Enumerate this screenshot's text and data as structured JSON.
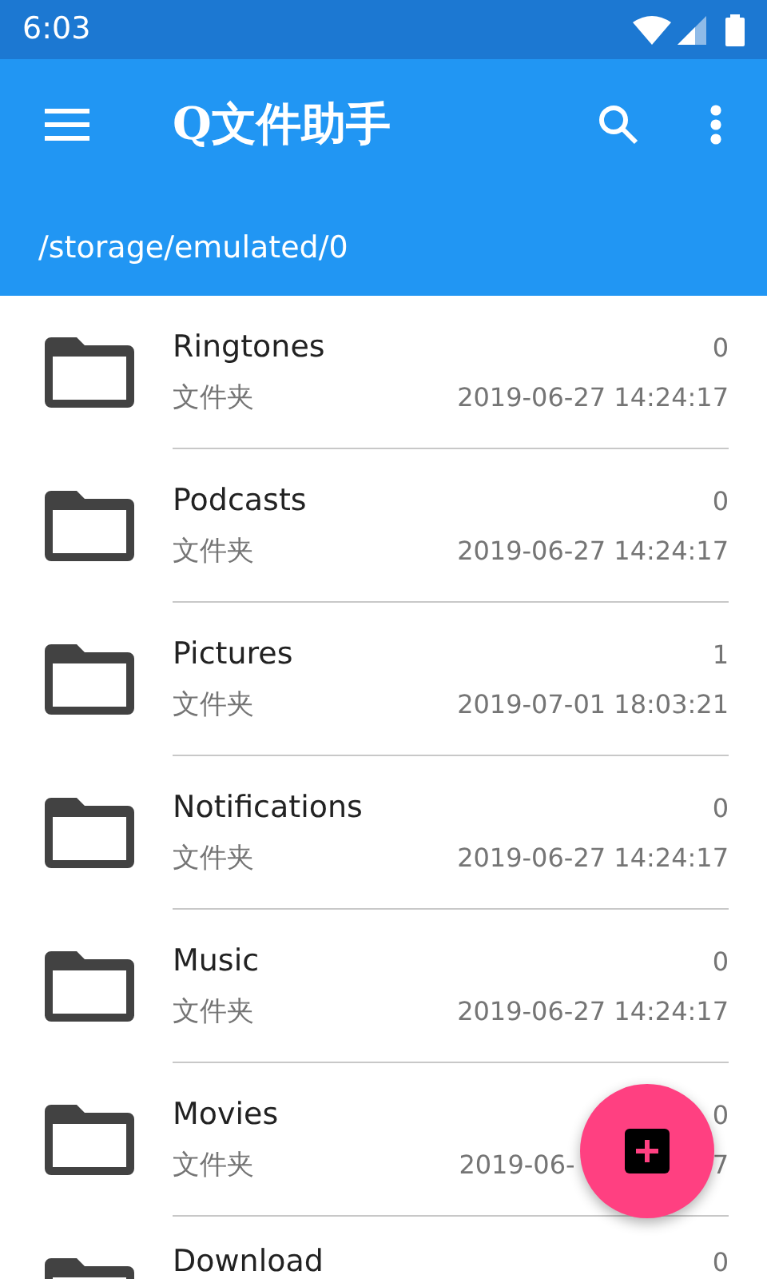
{
  "status_bar": {
    "time": "6:03"
  },
  "app_bar": {
    "title": "Q文件助手",
    "path": "/storage/emulated/0"
  },
  "files": [
    {
      "name": "Ringtones",
      "type": "文件夹",
      "count": "0",
      "modified": "2019-06-27 14:24:17"
    },
    {
      "name": "Podcasts",
      "type": "文件夹",
      "count": "0",
      "modified": "2019-06-27 14:24:17"
    },
    {
      "name": "Pictures",
      "type": "文件夹",
      "count": "1",
      "modified": "2019-07-01 18:03:21"
    },
    {
      "name": "Notifications",
      "type": "文件夹",
      "count": "0",
      "modified": "2019-06-27 14:24:17"
    },
    {
      "name": "Music",
      "type": "文件夹",
      "count": "0",
      "modified": "2019-06-27 14:24:17"
    },
    {
      "name": "Movies",
      "type": "文件夹",
      "count": "0",
      "modified": "2019-06-",
      "modified_end": "7"
    },
    {
      "name": "Download",
      "count": "0"
    }
  ]
}
